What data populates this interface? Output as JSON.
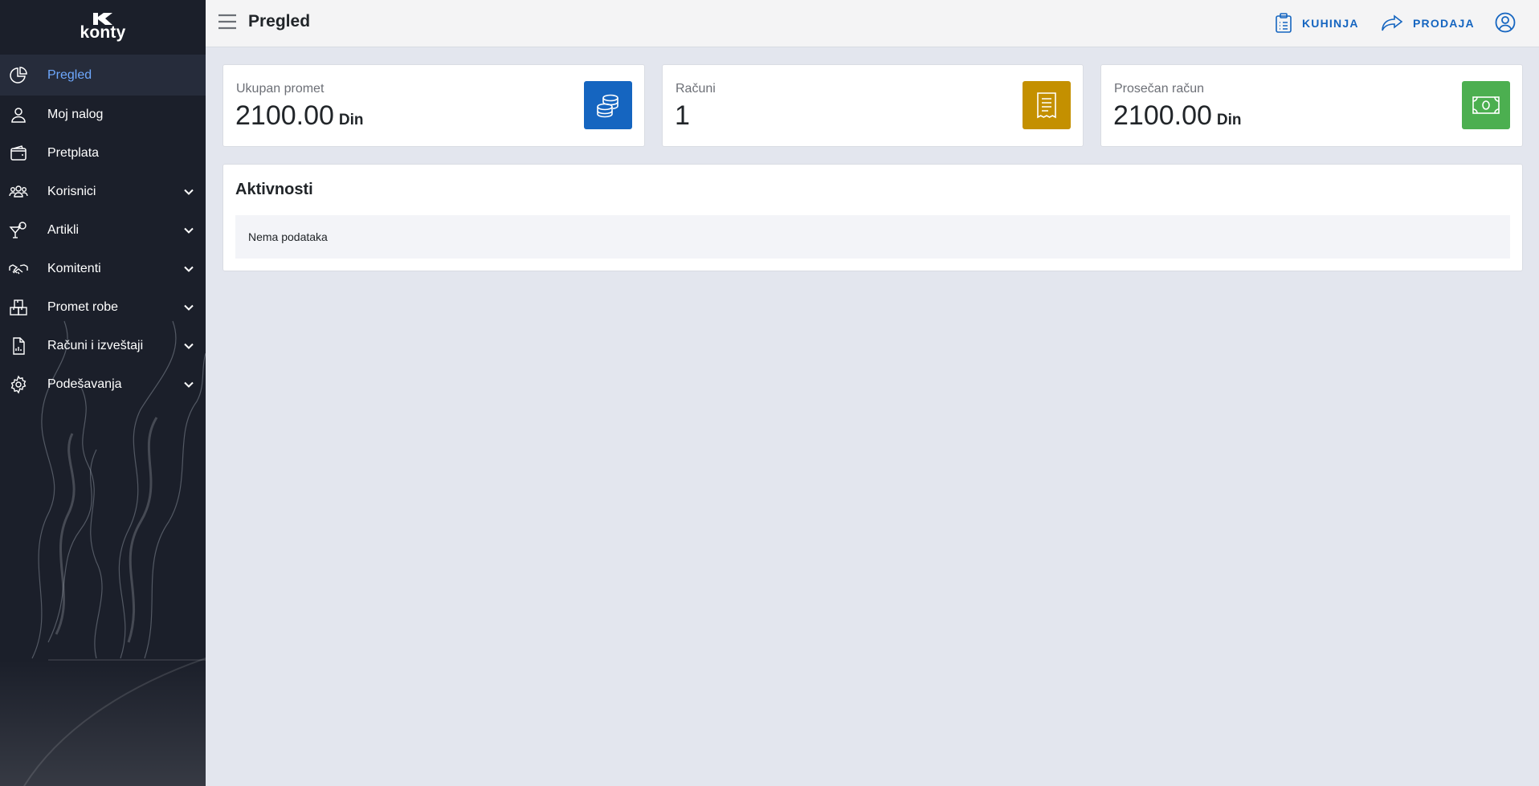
{
  "brand": {
    "logo_text": "konty"
  },
  "sidebar": {
    "items": [
      {
        "label": "Pregled",
        "icon": "pie-chart-icon",
        "active": true,
        "expandable": false
      },
      {
        "label": "Moj nalog",
        "icon": "user-icon",
        "active": false,
        "expandable": false
      },
      {
        "label": "Pretplata",
        "icon": "wallet-icon",
        "active": false,
        "expandable": false
      },
      {
        "label": "Korisnici",
        "icon": "users-icon",
        "active": false,
        "expandable": true
      },
      {
        "label": "Artikli",
        "icon": "cocktail-icon",
        "active": false,
        "expandable": true
      },
      {
        "label": "Komitenti",
        "icon": "handshake-icon",
        "active": false,
        "expandable": true
      },
      {
        "label": "Promet robe",
        "icon": "boxes-icon",
        "active": false,
        "expandable": true
      },
      {
        "label": "Računi i izveštaji",
        "icon": "report-icon",
        "active": false,
        "expandable": true
      },
      {
        "label": "Podešavanja",
        "icon": "gear-icon",
        "active": false,
        "expandable": true
      }
    ]
  },
  "header": {
    "title": "Pregled",
    "kuhinja_label": "KUHINJA",
    "prodaja_label": "PRODAJA"
  },
  "stats": [
    {
      "label": "Ukupan promet",
      "value": "2100.00",
      "unit": "Din",
      "icon": "coins-icon",
      "color": "#1565c0"
    },
    {
      "label": "Računi",
      "value": "1",
      "unit": "",
      "icon": "receipt-icon",
      "color": "#c49000"
    },
    {
      "label": "Prosečan račun",
      "value": "2100.00",
      "unit": "Din",
      "icon": "banknote-icon",
      "color": "#4caf50"
    }
  ],
  "activity": {
    "title": "Aktivnosti",
    "empty_text": "Nema podataka"
  },
  "colors": {
    "sidebar_bg": "#1b1f2a",
    "active_text": "#6ea8fe",
    "accent": "#1565c0",
    "page_bg": "#e3e6ee"
  }
}
